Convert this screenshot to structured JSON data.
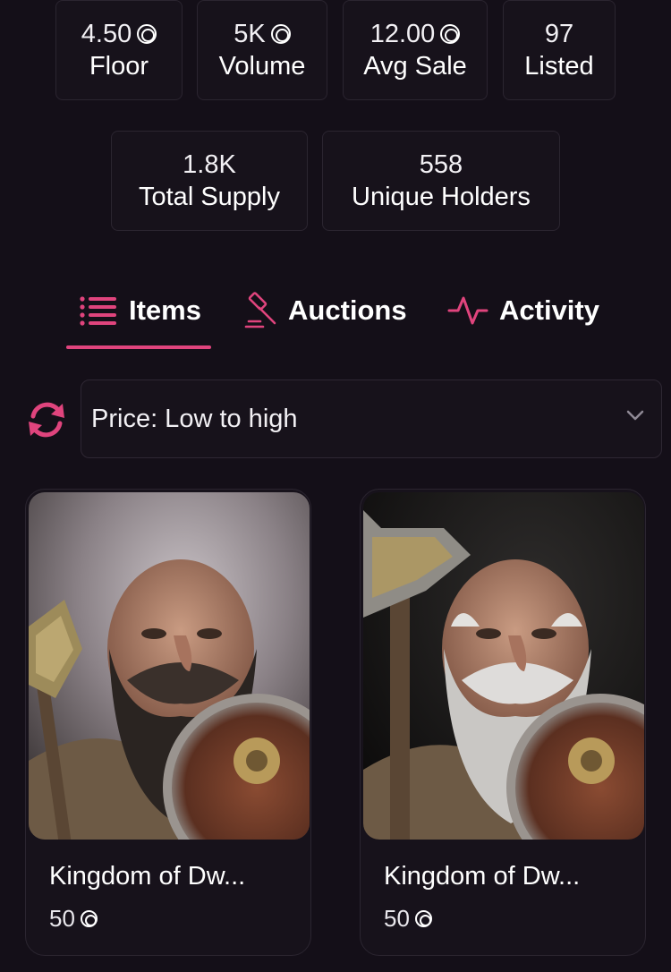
{
  "stats_row1": [
    {
      "value": "4.50",
      "label": "Floor",
      "currency_icon": "solana-coin-icon"
    },
    {
      "value": "5K",
      "label": "Volume",
      "currency_icon": "solana-coin-icon"
    },
    {
      "value": "12.00",
      "label": "Avg Sale",
      "currency_icon": "solana-coin-icon"
    },
    {
      "value": "97",
      "label": "Listed"
    }
  ],
  "stats_row2": [
    {
      "value": "1.8K",
      "label": "Total Supply"
    },
    {
      "value": "558",
      "label": "Unique Holders"
    }
  ],
  "tabs": [
    {
      "label": "Items",
      "icon": "list-icon",
      "active": true
    },
    {
      "label": "Auctions",
      "icon": "gavel-icon",
      "active": false
    },
    {
      "label": "Activity",
      "icon": "activity-pulse-icon",
      "active": false
    }
  ],
  "sort": {
    "selected": "Price: Low to high",
    "refresh_icon": "refresh-icon",
    "chevron_icon": "chevron-down-icon"
  },
  "cards": [
    {
      "name": "Kingdom of Dw...",
      "price": "50",
      "image": "dark-bearded-dwarf-with-axe-and-shield"
    },
    {
      "name": "Kingdom of Dw...",
      "price": "50",
      "image": "white-bearded-dwarf-with-axe-and-shield"
    }
  ],
  "colors": {
    "background": "#140f18",
    "accent": "#e0447d",
    "card_border": "#2b2530",
    "text": "#ffffff"
  }
}
